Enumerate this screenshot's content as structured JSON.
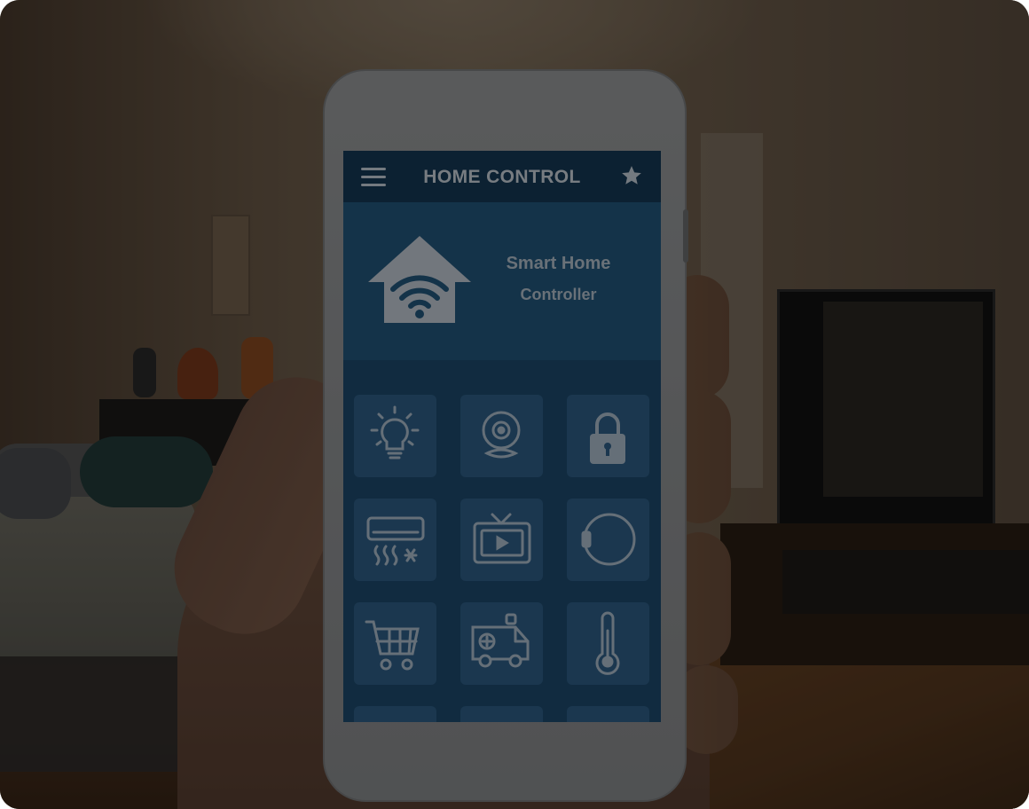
{
  "app": {
    "header_title": "HOME CONTROL",
    "hero_title": "Smart Home",
    "hero_subtitle": "Controller"
  },
  "colors": {
    "header_bg": "#163a57",
    "hero_bg": "#24587f",
    "grid_bg": "#1e4b6e",
    "tile_bg": "#2f6089",
    "icon_color": "#aebfcf"
  },
  "tiles": [
    {
      "icon": "lightbulb-icon"
    },
    {
      "icon": "webcam-icon"
    },
    {
      "icon": "padlock-icon"
    },
    {
      "icon": "air-conditioner-icon"
    },
    {
      "icon": "tv-icon"
    },
    {
      "icon": "round-device-icon"
    },
    {
      "icon": "shopping-cart-icon"
    },
    {
      "icon": "ambulance-icon"
    },
    {
      "icon": "thermometer-icon"
    }
  ]
}
